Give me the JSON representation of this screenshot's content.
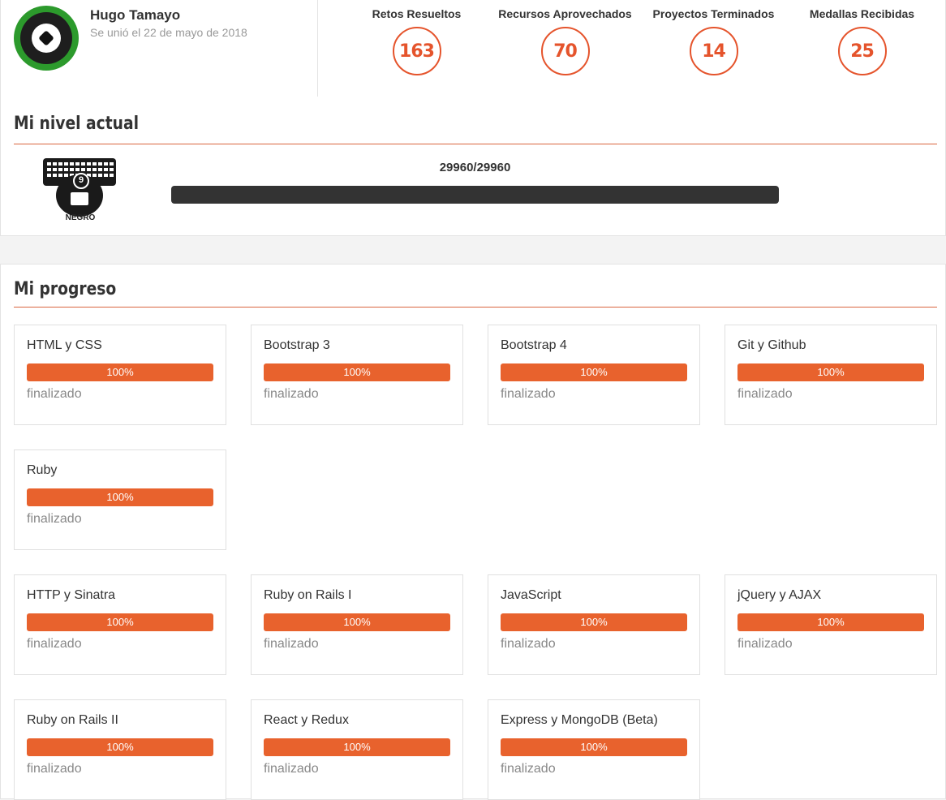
{
  "user": {
    "name": "Hugo Tamayo",
    "joined": "Se unió el 22 de mayo de 2018",
    "avatar_icon": "soccer-ball-icon"
  },
  "stats": [
    {
      "label": "Retos Resueltos",
      "value": "163"
    },
    {
      "label": "Recursos Aprovechados",
      "value": "70"
    },
    {
      "label": "Proyectos Terminados",
      "value": "14"
    },
    {
      "label": "Medallas Recibidas",
      "value": "25"
    }
  ],
  "level": {
    "title": "Mi nivel actual",
    "badge_icon": "black-belt-keyboard-icon",
    "badge_number": "9",
    "badge_label": "NEGRO",
    "score": "29960/29960",
    "progress": 1.0
  },
  "progress": {
    "title": "Mi progreso",
    "courses": [
      {
        "name": "HTML y CSS",
        "percent": "100%",
        "status": "finalizado"
      },
      {
        "name": "Bootstrap 3",
        "percent": "100%",
        "status": "finalizado"
      },
      {
        "name": "Bootstrap 4",
        "percent": "100%",
        "status": "finalizado"
      },
      {
        "name": "Git y Github",
        "percent": "100%",
        "status": "finalizado"
      },
      {
        "name": "Ruby",
        "percent": "100%",
        "status": "finalizado"
      },
      {
        "name": "HTTP y Sinatra",
        "percent": "100%",
        "status": "finalizado"
      },
      {
        "name": "Ruby on Rails I",
        "percent": "100%",
        "status": "finalizado"
      },
      {
        "name": "JavaScript",
        "percent": "100%",
        "status": "finalizado"
      },
      {
        "name": "jQuery y AJAX",
        "percent": "100%",
        "status": "finalizado"
      },
      {
        "name": "Ruby on Rails II",
        "percent": "100%",
        "status": "finalizado"
      },
      {
        "name": "React y Redux",
        "percent": "100%",
        "status": "finalizado"
      },
      {
        "name": "Express y MongoDB (Beta)",
        "percent": "100%",
        "status": "finalizado"
      }
    ]
  },
  "colors": {
    "accent": "#e8622d",
    "level_fill": "#333333"
  }
}
